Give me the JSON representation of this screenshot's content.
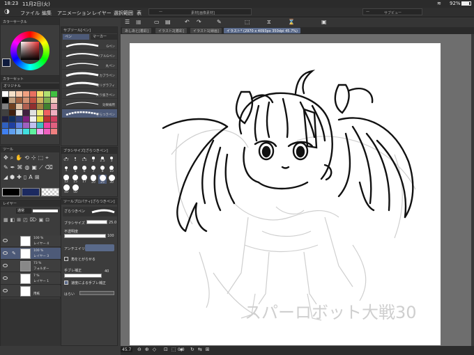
{
  "status": {
    "time": "18:23",
    "date": "11月2日(火)",
    "battery": "92%"
  },
  "menu": [
    "ファイル",
    "編集",
    "アニメーション",
    "レイヤー",
    "選択範囲",
    "表"
  ],
  "floating": {
    "nav_title": "素材[画像素材]",
    "subview_title": "サブビュー"
  },
  "tabs": [
    "あしあと[着彩]",
    "イラスト2[着彩]",
    "イラスト1[線画]",
    "イラスト* (2970 x 4093px 350dpi 45.7%)"
  ],
  "color_circle": {
    "title": "カラーサークル",
    "fg_color": "#0f1b3d",
    "bg_color": "#ffffff"
  },
  "color_set": {
    "title": "カラーセット",
    "set_name": "オリジナル"
  },
  "subtool": {
    "title": "サブツール[ペン]",
    "tabs": [
      "ペン",
      "マーカー"
    ],
    "brushes": [
      "Gペン",
      "リアルGペン",
      "丸ペン",
      "カブラペン",
      "カリグラフィ",
      "入り抜きペン",
      "効果線用",
      "ざらつきペン"
    ]
  },
  "tool": {
    "title": "ツール"
  },
  "brush_size": {
    "title": "ブラシサイズ[ざらつきペン]",
    "sizes": [
      "0.7",
      "1",
      "1.5",
      "2",
      "2.5",
      "3",
      "4",
      "5",
      "6",
      "7",
      "8",
      "10",
      "12",
      "15",
      "17",
      "20",
      "25",
      "30",
      "40",
      "50"
    ],
    "selected": "25"
  },
  "tool_property": {
    "title": "ツールプロパティ[ざらつきペン]",
    "tool_name": "ざらつきペン",
    "brush_size_label": "ブラシサイズ",
    "brush_size_value": "25.0",
    "opacity_label": "不透明度",
    "opacity_value": "100",
    "aa_label": "アンチエイリ",
    "shape_label": "角をとがらせる",
    "stab_label": "手ブレ補正",
    "stab_value": "40",
    "speed_label": "速度による手ブレ補正",
    "more_label": "はらい"
  },
  "layers": {
    "title": "レイヤー",
    "blend": "通常",
    "items": [
      {
        "pct": "100 %",
        "mode": "通常",
        "name": "レイヤー 4"
      },
      {
        "pct": "100 %",
        "mode": "通常",
        "name": "レイヤー 3"
      },
      {
        "pct": "73 %",
        "mode": "通常",
        "name": "フォルダー"
      },
      {
        "pct": "7 %",
        "mode": "通常",
        "name": "レイヤー 1"
      },
      {
        "pct": "",
        "mode": "",
        "name": "用紙"
      }
    ]
  },
  "bottom": {
    "zoom": "45.7",
    "angle": "0.0"
  },
  "artwork": {
    "sign_text": "スパーロボット大戦30"
  }
}
